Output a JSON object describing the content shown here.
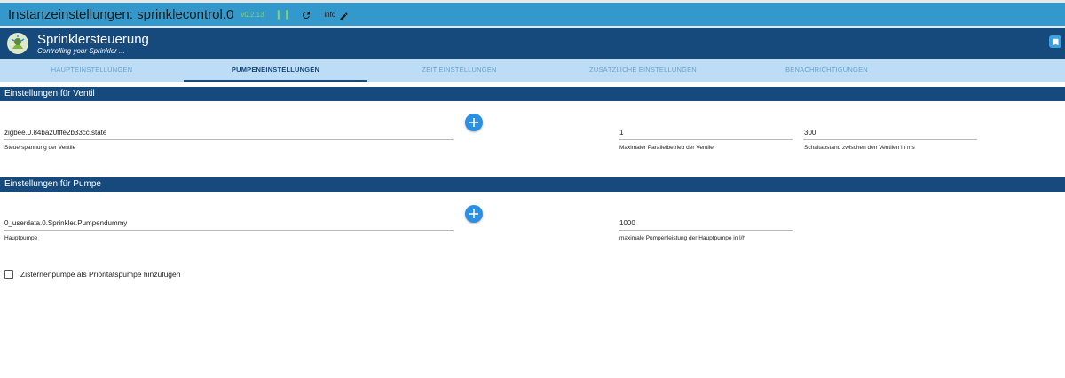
{
  "topbar": {
    "title": "Instanzeinstellungen: sprinklecontrol.0",
    "version": "v0.2.13",
    "pause_glyph": "❙❙",
    "info_label": "info"
  },
  "app": {
    "name": "Sprinklersteuerung",
    "subtitle": "Controlling your Sprinkler ..."
  },
  "tabs": [
    {
      "label": "HAUPTEINSTELLUNGEN",
      "active": false
    },
    {
      "label": "PUMPENEINSTELLUNGEN",
      "active": true
    },
    {
      "label": "ZEIT EINSTELLUNGEN",
      "active": false
    },
    {
      "label": "ZUSÄTZLICHE EINSTELLUNGEN",
      "active": false
    },
    {
      "label": "BENACHRICHTIGUNGEN",
      "active": false
    }
  ],
  "ventil": {
    "header": "Einstellungen für Ventil",
    "state": {
      "value": "zigbee.0.84ba20fffe2b33cc.state",
      "label": "Steuerspannung der Ventile"
    },
    "parallel": {
      "value": "1",
      "label": "Maximaler Parallelbetrieb der Ventile"
    },
    "abstand": {
      "value": "300",
      "label": "Schaltabstand zwischen den Ventilen in ms"
    }
  },
  "pumpe": {
    "header": "Einstellungen für Pumpe",
    "main": {
      "value": "0_userdata.0.Sprinkler.Pumpendummy",
      "label": "Hauptpumpe"
    },
    "power": {
      "value": "1000",
      "label": "maximale Pumpenleistung der Hauptpumpe in l/h"
    }
  },
  "checkbox": {
    "label": "Zisternenpumpe als Prioritätspumpe hinzufügen",
    "checked": false
  },
  "colors": {
    "topbar": "#3399cc",
    "appbar": "#174a7c",
    "tabs": "#bddcf5",
    "fab": "#2b8fe3",
    "version": "#7fd36b"
  }
}
